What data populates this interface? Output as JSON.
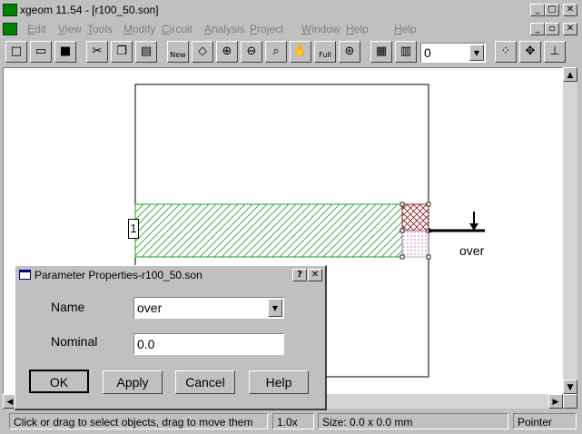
{
  "window": {
    "title": "xgeom 11.54 - [r100_50.son]",
    "controls": [
      "_",
      "□",
      "✕"
    ],
    "doc_controls": [
      "_",
      "▫",
      "✕"
    ]
  },
  "menu": {
    "items": [
      "File",
      "Edit",
      "View",
      "Tools",
      "Modify",
      "Circuit",
      "Analysis",
      "Project",
      "Window",
      "Help"
    ],
    "mnemonics": [
      "F",
      "E",
      "V",
      "T",
      "M",
      "C",
      "A",
      "P",
      "W",
      "H"
    ]
  },
  "toolbar": {
    "new_label": "New",
    "full_label": "Full",
    "level_value": "0"
  },
  "canvas": {
    "port_label": "1",
    "param_label": "over"
  },
  "dialog": {
    "title": "Parameter Properties-r100_50.son",
    "help_glyph": "?",
    "close_glyph": "✕",
    "name_label": "Name",
    "name_value": "over",
    "nominal_label": "Nominal",
    "nominal_value": "0.0",
    "buttons": {
      "ok": "OK",
      "apply": "Apply",
      "cancel": "Cancel",
      "help": "Help"
    }
  },
  "status": {
    "message": "Click or drag to select objects, drag to move them",
    "zoom": "1.0x",
    "size": "Size: 0.0 x 0.0 mm",
    "mode": "Pointer"
  },
  "colors": {
    "metal": "#2aa02a",
    "via": "#8b1a1a",
    "dielectric": "#c060c0"
  }
}
